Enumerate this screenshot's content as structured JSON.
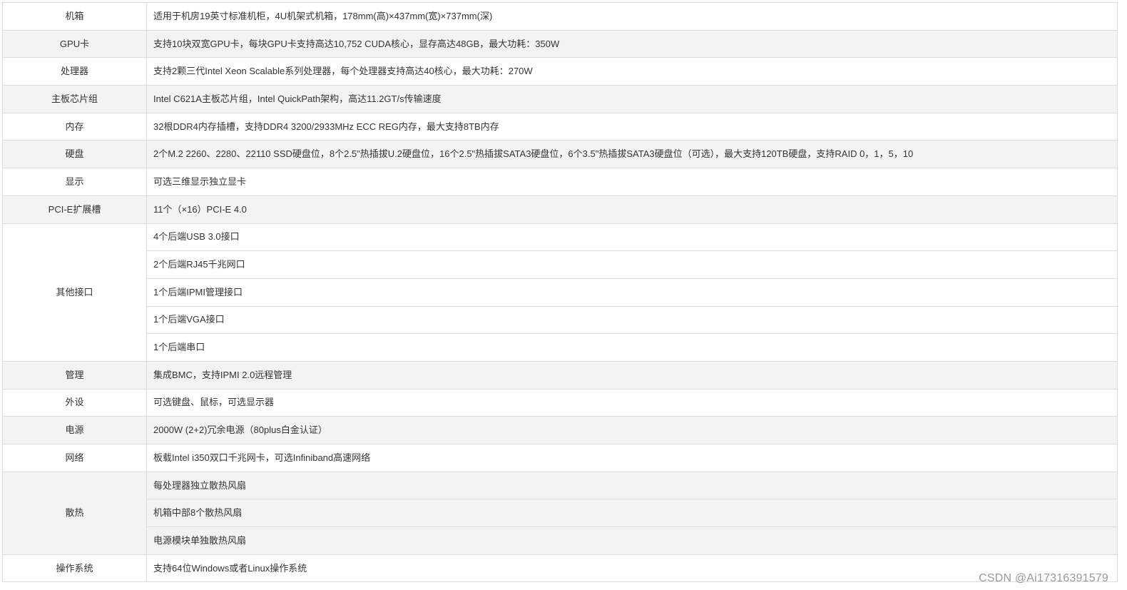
{
  "rows": [
    {
      "label": "机箱",
      "values": [
        "适用于机房19英寸标准机柜，4U机架式机箱，178mm(高)×437mm(宽)×737mm(深)"
      ]
    },
    {
      "label": "GPU卡",
      "values": [
        "支持10块双宽GPU卡，每块GPU卡支持高达10,752 CUDA核心，显存高达48GB，最大功耗：350W"
      ]
    },
    {
      "label": "处理器",
      "values": [
        "支持2颗三代Intel Xeon Scalable系列处理器，每个处理器支持高达40核心，最大功耗：270W"
      ]
    },
    {
      "label": "主板芯片组",
      "values": [
        "Intel C621A主板芯片组，Intel QuickPath架构，高达11.2GT/s传输速度"
      ]
    },
    {
      "label": "内存",
      "values": [
        "32根DDR4内存插槽，支持DDR4 3200/2933MHz ECC REG内存，最大支持8TB内存"
      ]
    },
    {
      "label": "硬盘",
      "values": [
        "2个M.2 2260、2280、22110 SSD硬盘位，8个2.5\"热插拔U.2硬盘位，16个2.5\"热插拔SATA3硬盘位，6个3.5\"热插拔SATA3硬盘位（可选），最大支持120TB硬盘，支持RAID 0，1，5，10"
      ]
    },
    {
      "label": "显示",
      "values": [
        "可选三维显示独立显卡"
      ]
    },
    {
      "label": "PCI-E扩展槽",
      "values": [
        "11个（×16）PCI-E 4.0"
      ]
    },
    {
      "label": "其他接口",
      "values": [
        "4个后端USB 3.0接口",
        "2个后端RJ45千兆网口",
        "1个后端IPMI管理接口",
        "1个后端VGA接口",
        "1个后端串口"
      ]
    },
    {
      "label": "管理",
      "values": [
        "集成BMC，支持IPMI 2.0远程管理"
      ]
    },
    {
      "label": "外设",
      "values": [
        "可选键盘、鼠标，可选显示器"
      ]
    },
    {
      "label": "电源",
      "values": [
        "2000W (2+2)冗余电源（80plus白金认证）"
      ]
    },
    {
      "label": "网络",
      "values": [
        "板载Intel i350双口千兆网卡，可选Infiniband高速网络"
      ]
    },
    {
      "label": "散热",
      "values": [
        "每处理器独立散热风扇",
        "机箱中部8个散热风扇",
        "电源模块单独散热风扇"
      ]
    },
    {
      "label": "操作系统",
      "values": [
        "支持64位Windows或者Linux操作系统"
      ]
    }
  ],
  "watermark": "CSDN @Ai17316391579"
}
